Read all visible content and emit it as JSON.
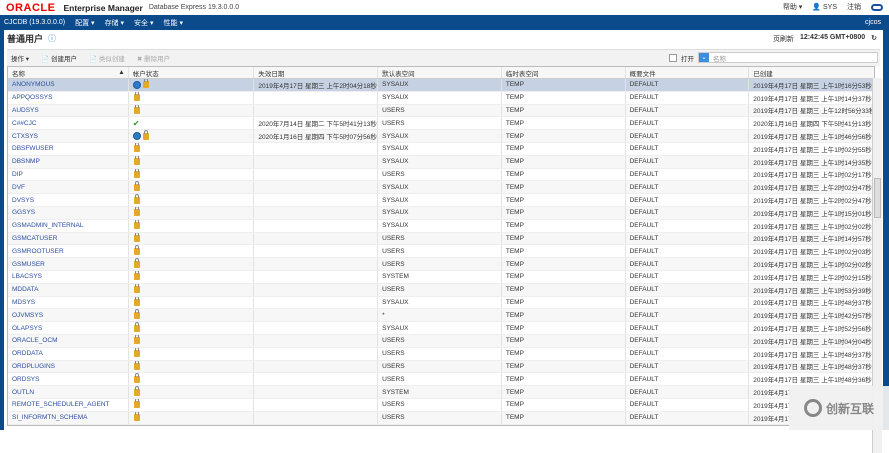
{
  "header": {
    "logo": "ORACLE",
    "product": "Enterprise Manager",
    "edition": "Database Express 19.3.0.0.0",
    "help": "帮助 ▾",
    "user": "SYS",
    "logout": "注销"
  },
  "nav": {
    "db": "CJCDB (19.3.0.0.0)",
    "items": [
      "配置 ▾",
      "存储 ▾",
      "安全 ▾",
      "性能 ▾"
    ],
    "host": "cjcos"
  },
  "page": {
    "title": "普通用户",
    "refresh_label": "页刷新",
    "refresh_time": "12:42:45 GMT+0800"
  },
  "toolbar": {
    "actions": "操作 ▾",
    "create": "创建用户",
    "create_like": "类似创建",
    "delete": "删除用户",
    "open_label": "打开",
    "search_placeholder": "名称"
  },
  "table": {
    "columns": [
      "名称",
      "帐户状态",
      "失效日期",
      "默认表空间",
      "临时表空间",
      "概要文件",
      "已创建"
    ],
    "rows": [
      {
        "name": "ANONYMOUS",
        "status": "expired-locked",
        "expiry": "2019年4月17日 星期三 上午2时04分18秒",
        "ts": "SYSAUX",
        "temp": "TEMP",
        "profile": "DEFAULT",
        "created": "2019年4月17日 星期三 上午1时16分53秒"
      },
      {
        "name": "APPQOSSYS",
        "status": "locked",
        "expiry": "",
        "ts": "SYSAUX",
        "temp": "TEMP",
        "profile": "DEFAULT",
        "created": "2019年4月17日 星期三 上午1时14分37秒"
      },
      {
        "name": "AUDSYS",
        "status": "locked",
        "expiry": "",
        "ts": "USERS",
        "temp": "TEMP",
        "profile": "DEFAULT",
        "created": "2019年4月17日 星期三 上午12时56分33秒"
      },
      {
        "name": "C##CJC",
        "status": "open",
        "expiry": "2020年7月14日 星期二 下午5时41分13秒*",
        "ts": "USERS",
        "temp": "TEMP",
        "profile": "DEFAULT",
        "created": "2020年1月16日 星期四 下午5时41分13秒"
      },
      {
        "name": "CTXSYS",
        "status": "expired-locked",
        "expiry": "2020年1月16日 星期四 下午5时07分56秒*",
        "ts": "SYSAUX",
        "temp": "TEMP",
        "profile": "DEFAULT",
        "created": "2019年4月17日 星期三 上午1时46分56秒"
      },
      {
        "name": "DBSFWUSER",
        "status": "locked",
        "expiry": "",
        "ts": "SYSAUX",
        "temp": "TEMP",
        "profile": "DEFAULT",
        "created": "2019年4月17日 星期三 上午1时02分55秒"
      },
      {
        "name": "DBSNMP",
        "status": "locked",
        "expiry": "",
        "ts": "SYSAUX",
        "temp": "TEMP",
        "profile": "DEFAULT",
        "created": "2019年4月17日 星期三 上午1时14分35秒"
      },
      {
        "name": "DIP",
        "status": "locked",
        "expiry": "",
        "ts": "USERS",
        "temp": "TEMP",
        "profile": "DEFAULT",
        "created": "2019年4月17日 星期三 上午1时02分17秒"
      },
      {
        "name": "DVF",
        "status": "locked",
        "expiry": "",
        "ts": "SYSAUX",
        "temp": "TEMP",
        "profile": "DEFAULT",
        "created": "2019年4月17日 星期三 上午2时02分47秒"
      },
      {
        "name": "DVSYS",
        "status": "locked",
        "expiry": "",
        "ts": "SYSAUX",
        "temp": "TEMP",
        "profile": "DEFAULT",
        "created": "2019年4月17日 星期三 上午2时02分47秒"
      },
      {
        "name": "GGSYS",
        "status": "locked",
        "expiry": "",
        "ts": "SYSAUX",
        "temp": "TEMP",
        "profile": "DEFAULT",
        "created": "2019年4月17日 星期三 上午1时15分01秒"
      },
      {
        "name": "GSMADMIN_INTERNAL",
        "status": "locked",
        "expiry": "",
        "ts": "SYSAUX",
        "temp": "TEMP",
        "profile": "DEFAULT",
        "created": "2019年4月17日 星期三 上午1时02分02秒"
      },
      {
        "name": "GSMCATUSER",
        "status": "locked",
        "expiry": "",
        "ts": "USERS",
        "temp": "TEMP",
        "profile": "DEFAULT",
        "created": "2019年4月17日 星期三 上午1时14分57秒"
      },
      {
        "name": "GSMROOTUSER",
        "status": "locked",
        "expiry": "",
        "ts": "USERS",
        "temp": "TEMP",
        "profile": "DEFAULT",
        "created": "2019年4月17日 星期三 上午1时02分03秒"
      },
      {
        "name": "GSMUSER",
        "status": "locked",
        "expiry": "",
        "ts": "USERS",
        "temp": "TEMP",
        "profile": "DEFAULT",
        "created": "2019年4月17日 星期三 上午1时02分02秒"
      },
      {
        "name": "LBACSYS",
        "status": "locked",
        "expiry": "",
        "ts": "SYSTEM",
        "temp": "TEMP",
        "profile": "DEFAULT",
        "created": "2019年4月17日 星期三 上午2时02分15秒"
      },
      {
        "name": "MDDATA",
        "status": "locked",
        "expiry": "",
        "ts": "USERS",
        "temp": "TEMP",
        "profile": "DEFAULT",
        "created": "2019年4月17日 星期三 上午1时53分39秒"
      },
      {
        "name": "MDSYS",
        "status": "locked",
        "expiry": "",
        "ts": "SYSAUX",
        "temp": "TEMP",
        "profile": "DEFAULT",
        "created": "2019年4月17日 星期三 上午1时48分37秒"
      },
      {
        "name": "OJVMSYS",
        "status": "locked",
        "expiry": "",
        "ts": "*",
        "temp": "TEMP",
        "profile": "DEFAULT",
        "created": "2019年4月17日 星期三 上午1时42分57秒"
      },
      {
        "name": "OLAPSYS",
        "status": "locked",
        "expiry": "",
        "ts": "SYSAUX",
        "temp": "TEMP",
        "profile": "DEFAULT",
        "created": "2019年4月17日 星期三 上午1时52分56秒"
      },
      {
        "name": "ORACLE_OCM",
        "status": "locked",
        "expiry": "",
        "ts": "USERS",
        "temp": "TEMP",
        "profile": "DEFAULT",
        "created": "2019年4月17日 星期三 上午1时04分04秒"
      },
      {
        "name": "ORDDATA",
        "status": "locked",
        "expiry": "",
        "ts": "USERS",
        "temp": "TEMP",
        "profile": "DEFAULT",
        "created": "2019年4月17日 星期三 上午1时48分37秒"
      },
      {
        "name": "ORDPLUGINS",
        "status": "locked",
        "expiry": "",
        "ts": "USERS",
        "temp": "TEMP",
        "profile": "DEFAULT",
        "created": "2019年4月17日 星期三 上午1时48分37秒"
      },
      {
        "name": "ORDSYS",
        "status": "locked",
        "expiry": "",
        "ts": "USERS",
        "temp": "TEMP",
        "profile": "DEFAULT",
        "created": "2019年4月17日 星期三 上午1时48分36秒"
      },
      {
        "name": "OUTLN",
        "status": "locked",
        "expiry": "",
        "ts": "SYSTEM",
        "temp": "TEMP",
        "profile": "DEFAULT",
        "created": "2019年4月17"
      },
      {
        "name": "REMOTE_SCHEDULER_AGENT",
        "status": "locked",
        "expiry": "",
        "ts": "USERS",
        "temp": "TEMP",
        "profile": "DEFAULT",
        "created": "2019年4月17"
      },
      {
        "name": "SI_INFORMTN_SCHEMA",
        "status": "locked",
        "expiry": "",
        "ts": "USERS",
        "temp": "TEMP",
        "profile": "DEFAULT",
        "created": "2019年4月17"
      }
    ]
  },
  "watermark": {
    "text": "创新互联"
  }
}
